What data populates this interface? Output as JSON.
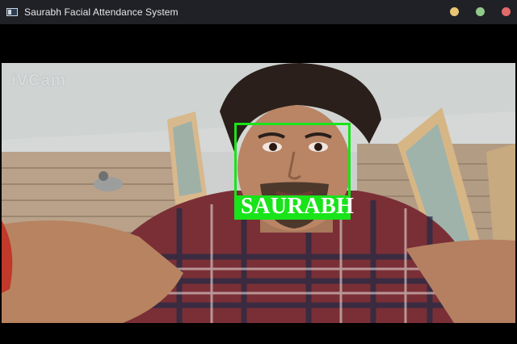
{
  "window": {
    "title": "Saurabh Facial Attendance System",
    "controls": [
      {
        "name": "minimize",
        "color": "#e8c574"
      },
      {
        "name": "maximize",
        "color": "#91c98a"
      },
      {
        "name": "close",
        "color": "#e36a6a"
      }
    ]
  },
  "camera": {
    "watermark": "iVCam",
    "detection": {
      "label": "SAURABH",
      "box_color": "#19e41a"
    }
  }
}
